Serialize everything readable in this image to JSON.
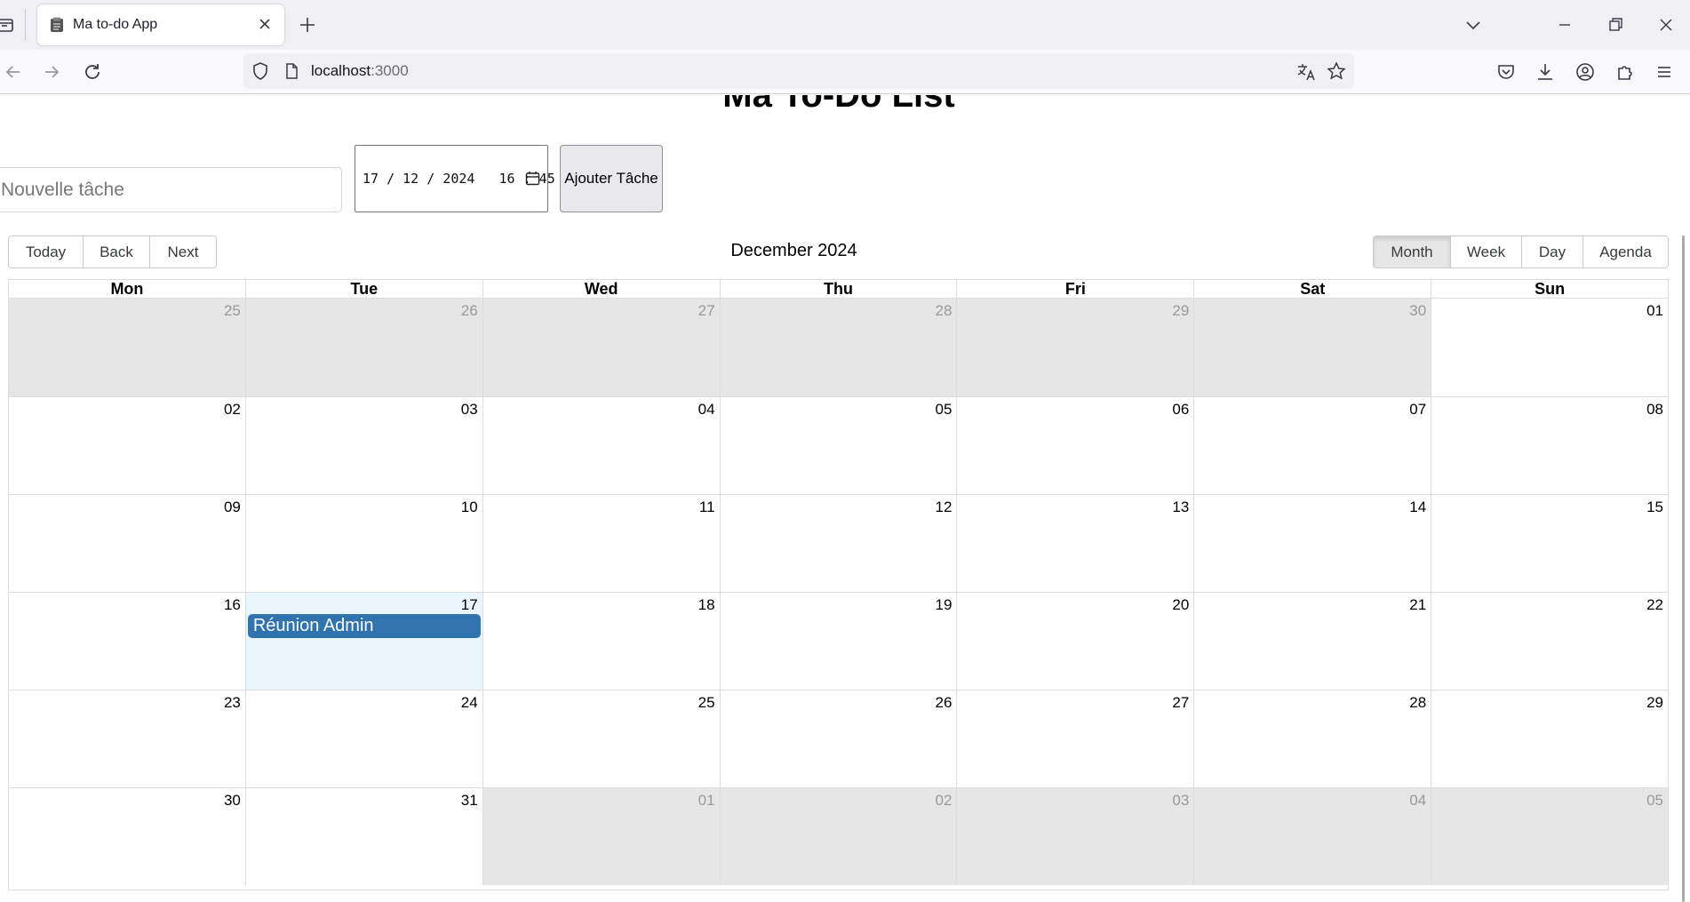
{
  "browser": {
    "tab_title": "Ma to-do App",
    "url_host": "localhost",
    "url_port": ":3000"
  },
  "page": {
    "title": "Ma To-Do List",
    "task_input_placeholder": "Nouvelle tâche",
    "datetime_value": "17 / 12 / 2024   16 : 45",
    "add_button": "Ajouter Tâche"
  },
  "toolbar": {
    "today": "Today",
    "back": "Back",
    "next": "Next",
    "label": "December 2024",
    "views": [
      "Month",
      "Week",
      "Day",
      "Agenda"
    ],
    "active_view": "Month"
  },
  "calendar": {
    "weekdays": [
      "Mon",
      "Tue",
      "Wed",
      "Thu",
      "Fri",
      "Sat",
      "Sun"
    ],
    "weeks": [
      [
        {
          "d": "25",
          "off": true
        },
        {
          "d": "26",
          "off": true
        },
        {
          "d": "27",
          "off": true
        },
        {
          "d": "28",
          "off": true
        },
        {
          "d": "29",
          "off": true
        },
        {
          "d": "30",
          "off": true
        },
        {
          "d": "01"
        }
      ],
      [
        {
          "d": "02"
        },
        {
          "d": "03"
        },
        {
          "d": "04"
        },
        {
          "d": "05"
        },
        {
          "d": "06"
        },
        {
          "d": "07"
        },
        {
          "d": "08"
        }
      ],
      [
        {
          "d": "09"
        },
        {
          "d": "10"
        },
        {
          "d": "11"
        },
        {
          "d": "12"
        },
        {
          "d": "13"
        },
        {
          "d": "14"
        },
        {
          "d": "15"
        }
      ],
      [
        {
          "d": "16"
        },
        {
          "d": "17",
          "today": true,
          "event": "Réunion Admin"
        },
        {
          "d": "18"
        },
        {
          "d": "19"
        },
        {
          "d": "20"
        },
        {
          "d": "21"
        },
        {
          "d": "22"
        }
      ],
      [
        {
          "d": "23"
        },
        {
          "d": "24"
        },
        {
          "d": "25"
        },
        {
          "d": "26"
        },
        {
          "d": "27"
        },
        {
          "d": "28"
        },
        {
          "d": "29"
        }
      ],
      [
        {
          "d": "30"
        },
        {
          "d": "31"
        },
        {
          "d": "01",
          "off": true
        },
        {
          "d": "02",
          "off": true
        },
        {
          "d": "03",
          "off": true
        },
        {
          "d": "04",
          "off": true
        },
        {
          "d": "05",
          "off": true
        }
      ]
    ],
    "event_color": "#3174ad",
    "today_color": "#eaf6ff",
    "off_range_color": "#e6e6e6"
  }
}
